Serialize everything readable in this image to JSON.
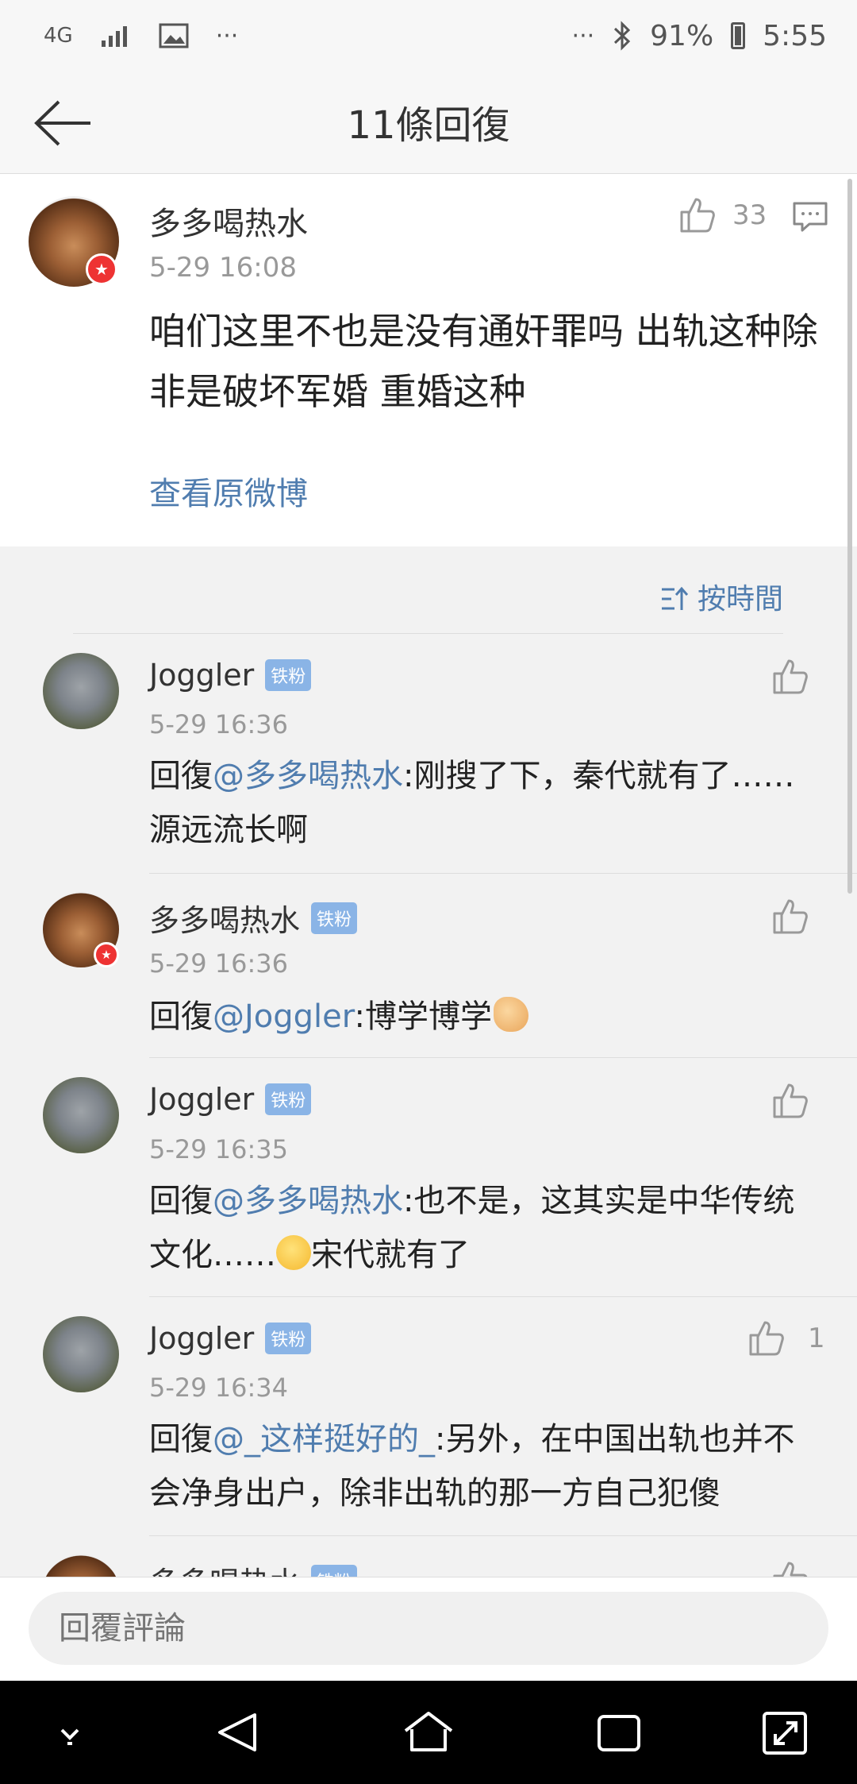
{
  "status_bar": {
    "network": "4G",
    "more_left": "···",
    "more_right": "···",
    "battery": "91%",
    "time": "5:55"
  },
  "header": {
    "title": "11條回復"
  },
  "main_comment": {
    "author": "多多喝热水",
    "time": "5-29 16:08",
    "like_count": "33",
    "text": "咱们这里不也是没有通奸罪吗 出轨这种除非是破坏军婚 重婚这种",
    "view_original": "查看原微博"
  },
  "sort_label": "按時間",
  "replies": [
    {
      "author": "Joggler",
      "badge": "铁粉",
      "time": "5-29 16:36",
      "prefix": "回復",
      "mention": "@多多喝热水",
      "text": ":刚搜了下，秦代就有了……源远流长啊",
      "like_count": ""
    },
    {
      "author": "多多喝热水",
      "badge": "铁粉",
      "time": "5-29 16:36",
      "prefix": "回復",
      "mention": "@Joggler",
      "text": ":博学博学",
      "like_count": ""
    },
    {
      "author": "Joggler",
      "badge": "铁粉",
      "time": "5-29 16:35",
      "prefix": "回復",
      "mention": "@多多喝热水",
      "text_a": ":也不是，这其实是中华传统文化……",
      "text_b": "宋代就有了",
      "like_count": ""
    },
    {
      "author": "Joggler",
      "badge": "铁粉",
      "time": "5-29 16:34",
      "prefix": "回復",
      "mention": "@_这样挺好的_",
      "text": ":另外，在中国出轨也并不会净身出户，除非出轨的那一方自己犯傻",
      "like_count": "1"
    },
    {
      "author": "多多喝热水",
      "badge": "铁粉"
    }
  ],
  "reply_input": {
    "placeholder": "回覆評論"
  },
  "icons": {
    "back": "back-arrow-icon",
    "like": "thumbs-up-icon",
    "comment": "comment-icon",
    "sort": "sort-icon"
  },
  "colors": {
    "link": "#507daf",
    "badge": "#8ab4e6",
    "verified": "#e33333"
  }
}
